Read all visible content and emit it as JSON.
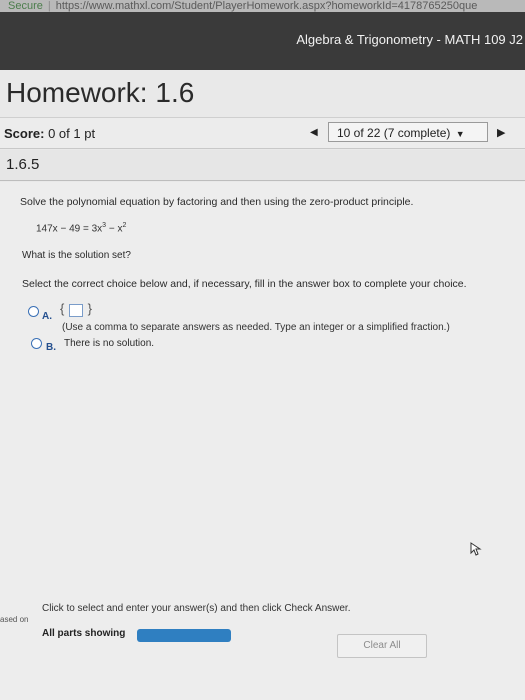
{
  "browser": {
    "security_label": "Secure",
    "url": "https://www.mathxl.com/Student/PlayerHomework.aspx?homeworkId=4178765250que"
  },
  "header": {
    "course_title": "Algebra & Trigonometry - MATH 109 J2"
  },
  "homework": {
    "title": "Homework: 1.6"
  },
  "score": {
    "label": "Score:",
    "value": "0 of 1 pt"
  },
  "navigation": {
    "prev_icon": "triangle-left-icon",
    "position_label": "10 of 22 (7 complete)",
    "dropdown_icon": "caret-down-icon",
    "next_icon": "triangle-right-icon"
  },
  "question": {
    "number": "1.6.5",
    "prompt": "Solve the polynomial equation by factoring and then using the zero-product principle.",
    "equation": {
      "lhs": "147x − 49 = 3x",
      "exp1": "3",
      "mid": " − x",
      "exp2": "2"
    },
    "solution_question": "What is the solution set?",
    "instruction": "Select the correct choice below and, if necessary, fill in the answer box to complete your choice.",
    "options": [
      {
        "letter": "A.",
        "open_brace": "{",
        "close_brace": "}",
        "hint": "(Use a comma to separate answers as needed. Type an integer or a simplified fraction.)"
      },
      {
        "letter": "B.",
        "text": "There is no solution."
      }
    ]
  },
  "footer": {
    "instructions": "Click to select and enter your answer(s) and then click Check Answer.",
    "side_text": "ased on",
    "parts_label": "All parts showing",
    "progress": 1.0,
    "clear_all_label": "Clear All"
  },
  "colors": {
    "header_bg": "#3a3a3a",
    "accent_blue": "#2f7fc1",
    "page_bg": "#e9e9e9"
  }
}
